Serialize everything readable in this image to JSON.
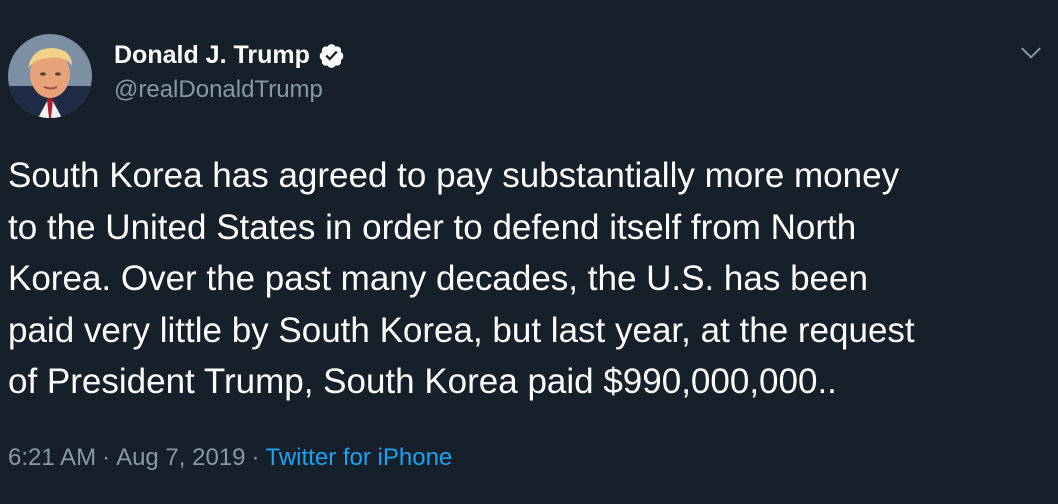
{
  "colors": {
    "background": "#15202b",
    "primary_text": "#ffffff",
    "secondary_text": "#8899a6",
    "link": "#1da1f2",
    "verified_badge": "#ffffff"
  },
  "author": {
    "display_name": "Donald J. Trump",
    "handle": "@realDonaldTrump",
    "verified": true,
    "verified_icon": "verified-badge-icon",
    "avatar_icon": "profile-avatar"
  },
  "menu": {
    "icon": "chevron-down-icon"
  },
  "tweet": {
    "text_lines": [
      "South Korea has agreed to pay substantially more money",
      "to the United States in order to defend itself from North",
      "Korea. Over the past many decades, the U.S. has been",
      "paid very little by South Korea, but last year, at the request",
      "of President Trump, South Korea paid $990,000,000.."
    ]
  },
  "meta": {
    "time": "6:21 AM",
    "separator": "·",
    "date": "Aug 7, 2019",
    "source": "Twitter for iPhone"
  }
}
